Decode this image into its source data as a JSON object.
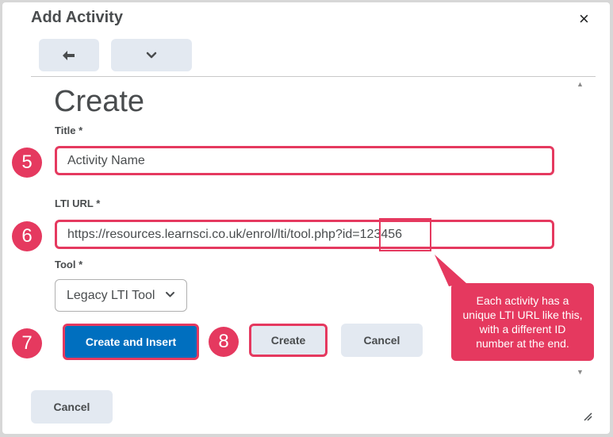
{
  "dialog": {
    "title": "Add Activity",
    "close_glyph": "×"
  },
  "nav": {
    "back_icon": "arrow-left-icon",
    "menu_icon": "chevron-down-icon"
  },
  "form": {
    "heading": "Create",
    "title_label": "Title *",
    "title_value": "Activity Name",
    "url_label": "LTI URL *",
    "url_value": "https://resources.learnsci.co.uk/enrol/lti/tool.php?id=",
    "url_id": "123456",
    "tool_label": "Tool *",
    "tool_value": "Legacy LTI Tool"
  },
  "buttons": {
    "create_insert": "Create and Insert",
    "create": "Create",
    "cancel": "Cancel",
    "footer_cancel": "Cancel"
  },
  "markers": [
    "5",
    "6",
    "7",
    "8"
  ],
  "callout": {
    "text": "Each activity has a unique LTI URL like this, with a different ID number at the end."
  },
  "colors": {
    "accent": "#e5395f",
    "primary": "#006fbf",
    "secondary_bg": "#e3e9f1"
  }
}
